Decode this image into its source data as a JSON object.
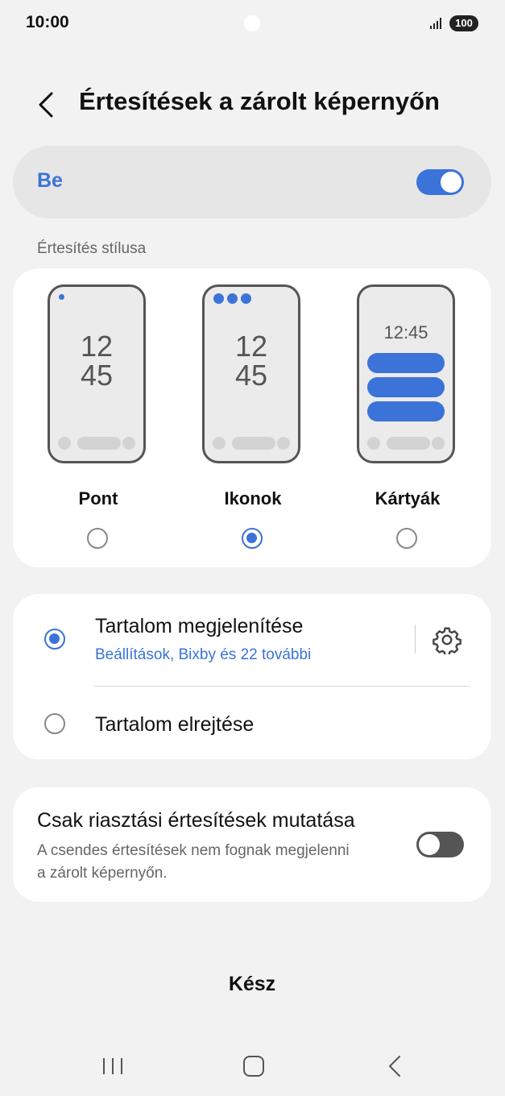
{
  "status_bar": {
    "time": "10:00",
    "battery": "100"
  },
  "header": {
    "title": "Értesítések a zárolt képernyőn",
    "back_icon": "chevron-left-icon"
  },
  "master_switch": {
    "label": "Be",
    "state": "on"
  },
  "style_section": {
    "label": "Értesítés stílusa",
    "options": [
      {
        "label": "Pont",
        "clock_line1": "12",
        "clock_line2": "45",
        "selected": false
      },
      {
        "label": "Ikonok",
        "clock_line1": "12",
        "clock_line2": "45",
        "selected": true
      },
      {
        "label": "Kártyák",
        "clock": "12:45",
        "selected": false
      }
    ]
  },
  "content_section": {
    "show": {
      "title": "Tartalom megjelenítése",
      "subtitle": "Beállítások, Bixby és 22 további",
      "selected": true,
      "settings_icon": "gear-icon"
    },
    "hide": {
      "title": "Tartalom elrejtése",
      "selected": false
    }
  },
  "alert_only": {
    "title": "Csak riasztási értesítések mutatása",
    "description": "A csendes értesítések nem fognak megjelenni a zárolt képernyőn.",
    "state": "off"
  },
  "done_button": "Kész",
  "nav_bar": {
    "recents_icon": "recents-icon",
    "home_icon": "home-icon",
    "back_icon": "back-icon"
  },
  "colors": {
    "accent": "#3b73d8",
    "background": "#f2f2f2",
    "card": "#ffffff"
  }
}
